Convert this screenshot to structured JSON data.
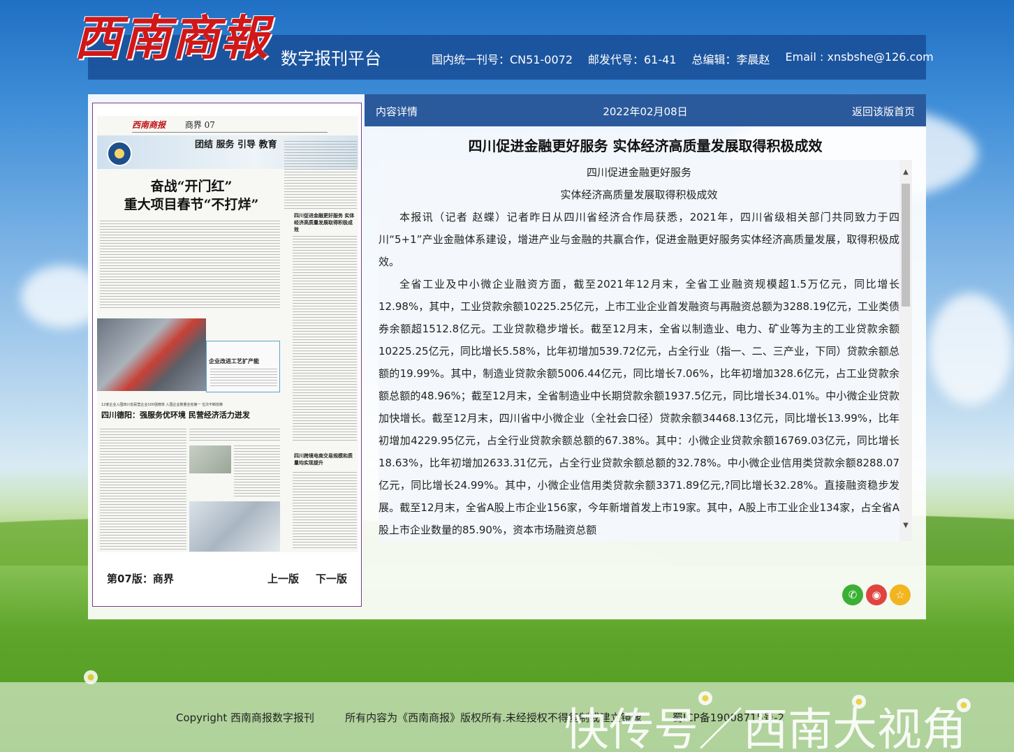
{
  "header": {
    "logo_text": "西南商報",
    "platform": "数字报刊平台",
    "info": [
      "国内统一刊号：CN51-0072",
      "邮发代号：61-41",
      "总编辑：李晨赵",
      "Email : xnsbshe@126.com"
    ]
  },
  "paper": {
    "masthead_logo": "西南商报",
    "masthead_section": "商界 07",
    "slogan": "团结 服务 引导 教育",
    "headline_1": "奋战“开门红”",
    "headline_2": "重大项目春节“不打烊”",
    "side_title": "四川促进金融更好服务 实体经济高质量发展取得积极成效",
    "box_title": "企业改进工艺扩产能",
    "sub_small": "12家企业入围四川省民营企业100强榜单 入围企业数量全省第一 位次不断前移",
    "sub_headline": "四川德阳：强服务优环境 民营经济活力迸发",
    "side_title2": "四川跨境电商交易规模和质量均实现提升",
    "edition": "第07版：商界",
    "prev": "上一版",
    "next": "下一版"
  },
  "detail": {
    "label": "内容详情",
    "date": "2022年02月08日",
    "back": "返回该版首页",
    "title": "四川促进金融更好服务 实体经济高质量发展取得积极成效",
    "sub1": "四川促进金融更好服务",
    "sub2": "实体经济高质量发展取得积极成效",
    "para1": "本报讯（记者 赵蝶）记者昨日从四川省经济合作局获悉，2021年，四川省级相关部门共同致力于四川“5+1”产业金融体系建设，增进产业与金融的共赢合作，促进金融更好服务实体经济高质量发展，取得积极成效。",
    "para2": "全省工业及中小微企业融资方面，截至2021年12月末，全省工业融资规模超1.5万亿元，同比增长12.98%，其中，工业贷款余额10225.25亿元，上市工业企业首发融资与再融资总额为3288.19亿元，工业类债券余额超1512.8亿元。工业贷款稳步增长。截至12月末，全省以制造业、电力、矿业等为主的工业贷款余额10225.25亿元，同比增长5.58%，比年初增加539.72亿元，占全行业（指一、二、三产业，下同）贷款余额总额的19.99%。其中，制造业贷款余额5006.44亿元，同比增长7.06%，比年初增加328.6亿元，占工业贷款余额总额的48.96%；截至12月末，全省制造业中长期贷款余额1937.5亿元，同比增长34.01%。中小微企业贷款加快增长。截至12月末，四川省中小微企业（全社会口径）贷款余额34468.13亿元，同比增长13.99%，比年初增加4229.95亿元，占全行业贷款余额总额的67.38%。其中：小微企业贷款余额16769.03亿元，同比增长18.63%，比年初增加2633.31亿元，占全行业贷款余额总额的32.78%。中小微企业信用类贷款余额8288.07亿元，同比增长24.99%。其中，小微企业信用类贷款余额3371.89亿元,?同比增长32.28%。直接融资稳步发展。截至12月末，全省A股上市企业156家，今年新增首发上市19家。其中，A股上市工业企业134家，占全省A股上市企业数量的85.90%，资本市场融资总额"
  },
  "share": {
    "wechat_icon": "wechat-icon",
    "weibo_icon": "weibo-icon",
    "fav_icon": "star-icon"
  },
  "footer": {
    "copyright": "Copyright 西南商报数字报刊",
    "rights": "所有内容为《西南商报》版权所有.未经授权不得复制或建立镜像",
    "icp": "蜀ICP备19008715号-2",
    "watermark": "快传号／西南大视角"
  }
}
